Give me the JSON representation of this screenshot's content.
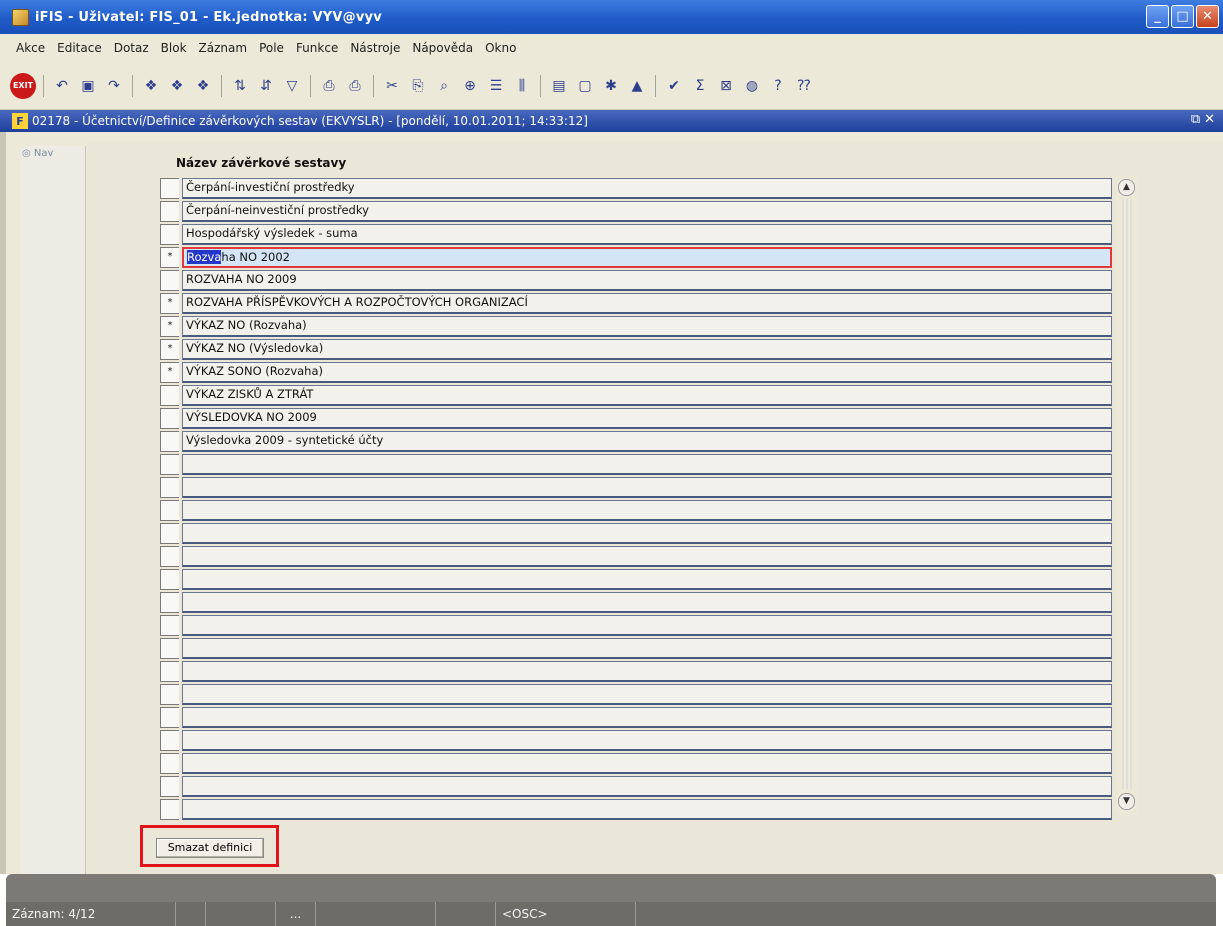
{
  "window": {
    "title": "iFIS - Uživatel: FIS_01 - Ek.jednotka: VYV@vyv"
  },
  "menu": [
    "Akce",
    "Editace",
    "Dotaz",
    "Blok",
    "Záznam",
    "Pole",
    "Funkce",
    "Nástroje",
    "Nápověda",
    "Okno"
  ],
  "toolbar": {
    "exit_label": "EXIT"
  },
  "form": {
    "title": "02178 - Účetnictví/Definice závěrkových sestav (EKVYSLR) - [pondělí, 10.01.2011; 14:33:12]",
    "nav_label": "Nav",
    "column_header": "Název závěrkové sestavy",
    "rows": [
      {
        "mark": "",
        "text": "Čerpání-investiční prostředky"
      },
      {
        "mark": "",
        "text": "Čerpání-neinvestiční prostředky"
      },
      {
        "mark": "",
        "text": "Hospodářský výsledek - suma"
      },
      {
        "mark": "*",
        "text_selected": "Rozva",
        "text_rest": "ha NO 2002"
      },
      {
        "mark": "",
        "text": "ROZVAHA NO 2009"
      },
      {
        "mark": "*",
        "text": "ROZVAHA PŘÍSPĚVKOVÝCH A ROZPOČTOVÝCH ORGANIZACÍ"
      },
      {
        "mark": "*",
        "text": "VÝKAZ NO (Rozvaha)"
      },
      {
        "mark": "*",
        "text": "VÝKAZ NO (Výsledovka)"
      },
      {
        "mark": "*",
        "text": "VÝKAZ SONO (Rozvaha)"
      },
      {
        "mark": "",
        "text": "VÝKAZ ZISKŮ A ZTRÁT"
      },
      {
        "mark": "",
        "text": "VÝSLEDOVKA NO 2009"
      },
      {
        "mark": "",
        "text": "Výsledovka 2009 - syntetické účty"
      }
    ],
    "button_delete": "Smazat definici"
  },
  "status": {
    "record": "Záznam: 4/12",
    "ellipsis": "...",
    "mode": "<OSC>"
  }
}
